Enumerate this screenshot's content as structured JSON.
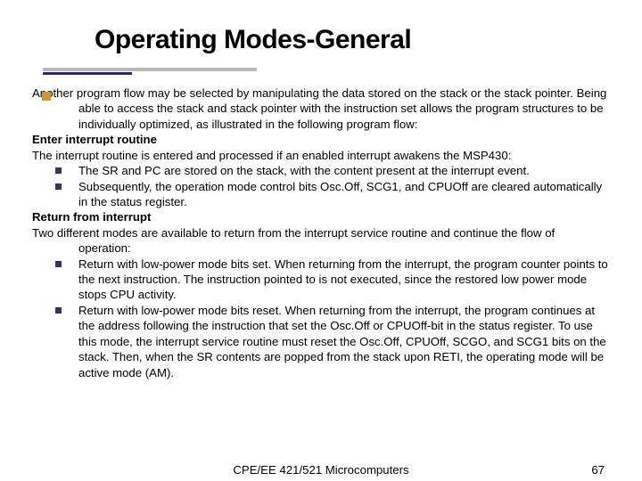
{
  "title": "Operating Modes-General",
  "para1": "Another program flow may be selected by manipulating the data stored on the stack or the stack pointer. Being able to access the stack and stack pointer with the instruction set allows the program structures to be individually optimized, as illustrated in the following program flow:",
  "head1": "Enter interrupt routine",
  "para2": "The interrupt routine is entered and processed if an enabled interrupt awakens the MSP430:",
  "bul1_1": "The SR and PC are stored on the stack, with the content present at the interrupt event.",
  "bul1_2": "Subsequently, the operation mode control bits Osc.Off, SCG1, and CPUOff are cleared automatically in the status register.",
  "head2": "Return from interrupt",
  "para3": "Two different modes are available to return from the interrupt service routine and continue the flow of operation:",
  "bul2_1": "Return with low-power mode bits set. When returning from the interrupt, the program counter points to the next instruction. The instruction pointed to is not executed, since the restored low power mode stops CPU activity.",
  "bul2_2": "Return with low-power mode bits reset. When returning from the interrupt, the program continues at the address following the instruction that set the Osc.Off or CPUOff-bit in the status register. To use this mode, the interrupt service routine must reset the Osc.Off, CPUOff, SCGO, and SCG1 bits on the stack. Then, when the SR contents are popped from the stack upon RETI, the operating mode will be active mode (AM).",
  "footer_center": "CPE/EE 421/521 Microcomputers",
  "footer_num": "67"
}
